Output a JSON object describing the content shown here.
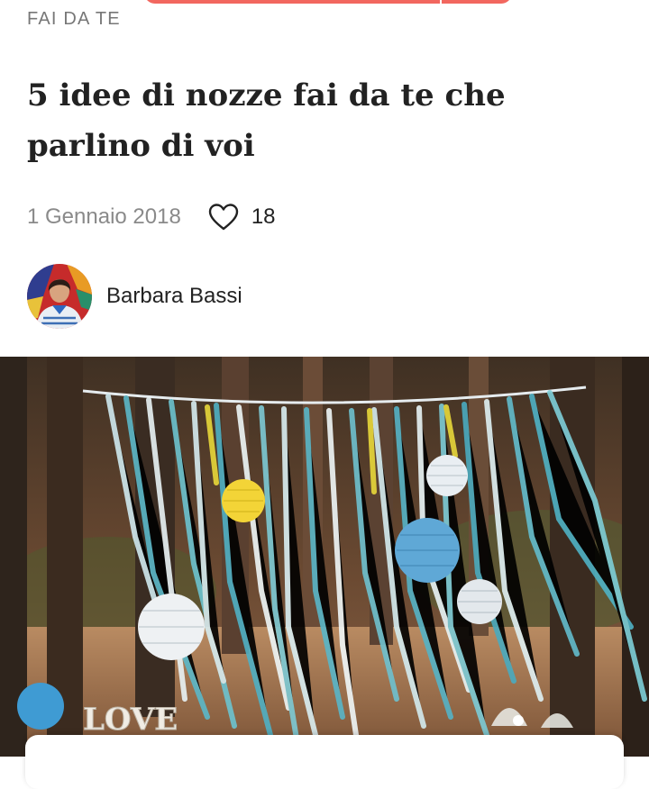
{
  "article": {
    "category": "FAI DA TE",
    "title": "5 idee di nozze fai da te che parlino di voi",
    "date": "1 Gennaio 2018",
    "likes": "18"
  },
  "author": {
    "name": "Barbara Bassi"
  },
  "hero_image": {
    "sign_text": "LOVE"
  },
  "colors": {
    "accent": "#f2675f",
    "ribbon_teal": "#5bb8c9",
    "lantern_yellow": "#f3d437",
    "lantern_blue": "#5fa8d6"
  },
  "icons": {
    "like": "heart-outline-icon"
  }
}
